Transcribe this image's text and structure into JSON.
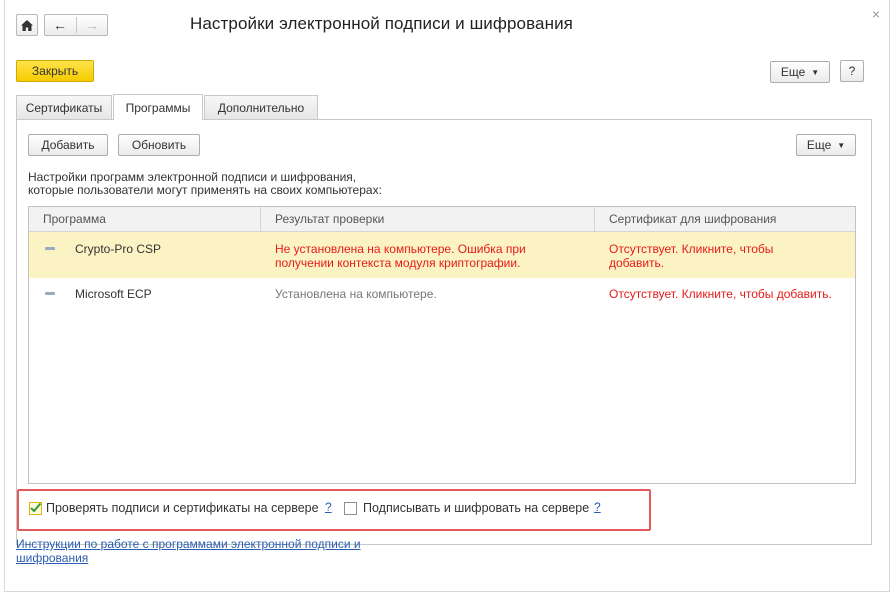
{
  "window": {
    "title": "Настройки электронной подписи и шифрования",
    "close_label": "×"
  },
  "toolbar": {
    "close_label": "Закрыть",
    "more_label": "Еще",
    "help_label": "?"
  },
  "tabs": [
    {
      "label": "Сертификаты",
      "active": false
    },
    {
      "label": "Программы",
      "active": true
    },
    {
      "label": "Дополнительно",
      "active": false
    }
  ],
  "panel": {
    "add_label": "Добавить",
    "refresh_label": "Обновить",
    "more_label": "Еще",
    "description_line1": "Настройки программ электронной подписи и шифрования,",
    "description_line2": "которые пользователи могут применять на своих компьютерах:"
  },
  "table": {
    "columns": [
      "Программа",
      "Результат проверки",
      "Сертификат для шифрования"
    ],
    "rows": [
      {
        "program": "Crypto-Pro CSP",
        "check_result_line1": "Не установлена на компьютере. Ошибка при",
        "check_result_line2": "получении контекста модуля криптографии.",
        "certificate_line1": "Отсутствует. Кликните, чтобы",
        "certificate_line2": "добавить.",
        "selected": true
      },
      {
        "program": "Microsoft ECP",
        "check_result": "Установлена на компьютере.",
        "certificate": "Отсутствует. Кликните, чтобы добавить.",
        "selected": false
      }
    ]
  },
  "options": {
    "verify_on_server_label": "Проверять подписи и сертификаты на сервере",
    "verify_on_server_checked": true,
    "sign_on_server_label": "Подписывать и шифровать на сервере",
    "sign_on_server_checked": false,
    "help_mark": "?"
  },
  "footer": {
    "instructions_link_line1": "Инструкции по работе с программами электронной подписи и",
    "instructions_link_line2": "шифрования"
  },
  "colors": {
    "accent_yellow": "#f5cc00",
    "selected_row": "#fcf3c4",
    "error_red": "#e41b1b",
    "link_blue": "#2a5db0",
    "highlight_border": "#e35a5a"
  }
}
